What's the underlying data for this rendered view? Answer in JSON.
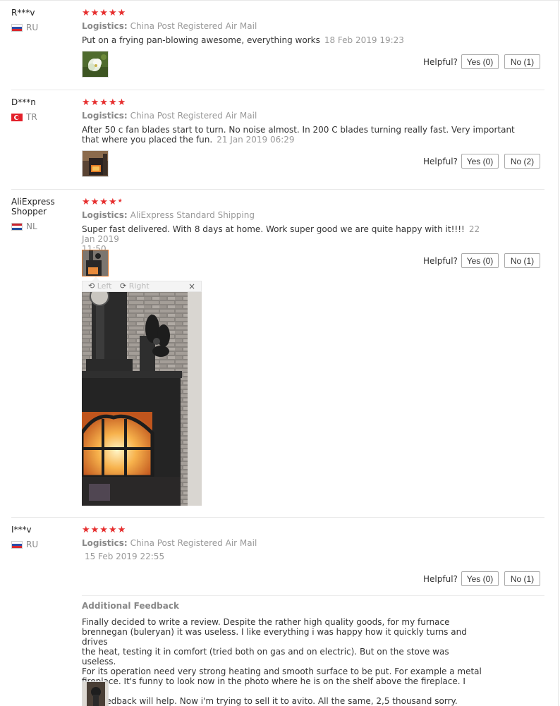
{
  "colors": {
    "star": "#e62e2e",
    "thumb_active": "#e07a2c",
    "muted": "#999999"
  },
  "reviews": [
    {
      "name": "R***v",
      "country": "RU",
      "flag_icon": "ru-flag-icon",
      "rating": 5,
      "stars": "★★★★★",
      "logistics_label": "Logistics:",
      "logistics": "China Post Registered Air Mail",
      "text": "Put on a frying pan-blowing awesome, everything works",
      "date": "18 Feb 2019 19:23",
      "helpful_label": "Helpful?",
      "yes_label": "Yes (0)",
      "no_label": "No (1)"
    },
    {
      "name": "D***n",
      "country": "TR",
      "flag_icon": "tr-flag-icon",
      "rating": 5,
      "stars": "★★★★★",
      "logistics_label": "Logistics:",
      "logistics": "China Post Registered Air Mail",
      "text_line1": "After 50 c fan blades start to turn. No noise almost. In 200 C blades turning really fast. Very important",
      "text_line2": "that where you placed the fun.",
      "date": "21 Jan 2019 06:29",
      "helpful_label": "Helpful?",
      "yes_label": "Yes (0)",
      "no_label": "No (2)"
    },
    {
      "name_line1": "AliExpress",
      "name_line2": "Shopper",
      "country": "NL",
      "flag_icon": "nl-flag-icon",
      "rating": 5,
      "stars": "★★★★",
      "logistics_label": "Logistics:",
      "logistics": "AliExpress Standard Shipping",
      "text_line1": "Super fast delivered. With 8 days at home. Work super good we are quite happy with it!!!!",
      "date_part1": "22 Jan 2019",
      "date_part2": "11:50",
      "helpful_label": "Helpful?",
      "yes_label": "Yes (0)",
      "no_label": "No (1)",
      "viewer": {
        "left_label": "Left",
        "right_label": "Right",
        "close_label": "×"
      }
    },
    {
      "name": "I***v",
      "country": "RU",
      "flag_icon": "ru-flag-icon",
      "rating": 5,
      "stars": "★★★★★",
      "logistics_label": "Logistics:",
      "logistics": "China Post Registered Air Mail",
      "date": "15 Feb 2019 22:55",
      "helpful_label": "Helpful?",
      "yes_label": "Yes (0)",
      "no_label": "No (1)",
      "additional_title": "Additional Feedback",
      "additional_lines": [
        "Finally decided to write a review. Despite the rather high quality goods, for my furnace",
        "brennegan (buleryan) it was useless. I like everything i was happy how it quickly turns and drives",
        "the heat, testing it in comfort (tried both on gas and on electric). But on the stove was useless.",
        "For its operation need very strong heating and smooth surface to be put. For example a metal",
        "fireplace. It's funny to look now in the photo where he is on the shelf above the fireplace. I hope",
        "my feedback will help. Now i'm trying to sell it to avito. All the same, 2,5 thousand sorry."
      ]
    }
  ]
}
